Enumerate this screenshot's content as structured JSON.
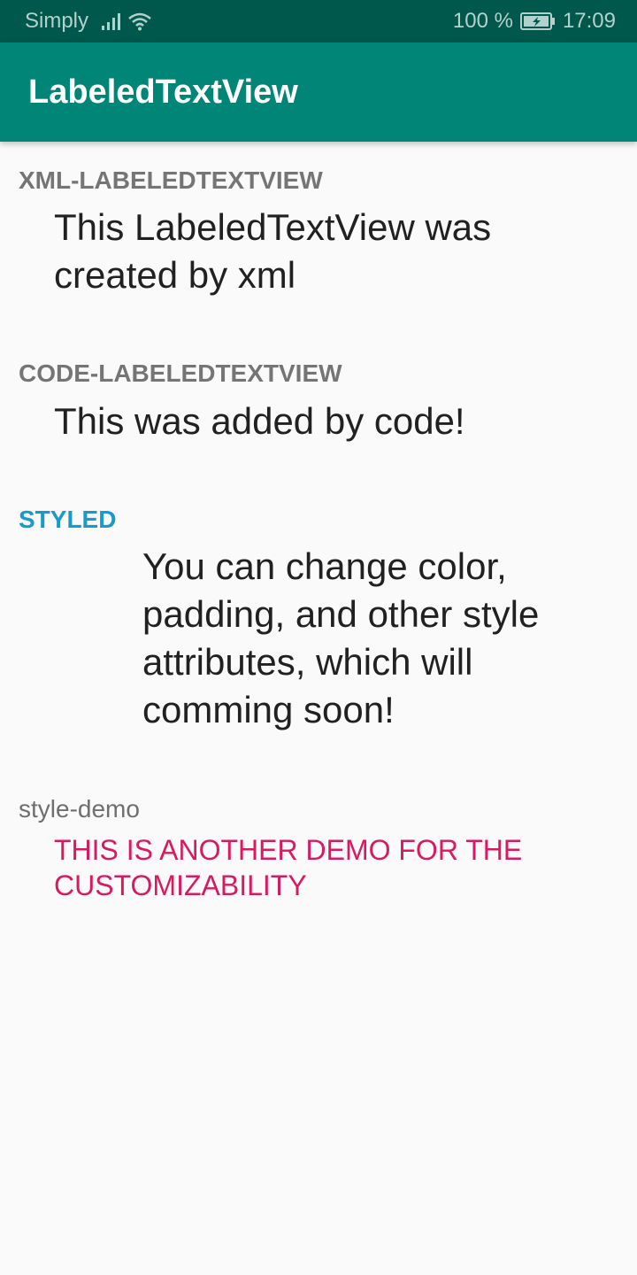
{
  "status_bar": {
    "carrier": "Simply",
    "battery_percent": "100 %",
    "time": "17:09",
    "icons": [
      "signal-icon",
      "wifi-icon",
      "battery-charging-icon"
    ],
    "background_color": "#00574b"
  },
  "app_bar": {
    "title": "LabeledTextView",
    "background_color": "#008577"
  },
  "items": [
    {
      "label": "XML-LABELEDTEXTVIEW",
      "value": "This LabeledTextView was created by xml",
      "label_color": "#757575"
    },
    {
      "label": "CODE-LABELEDTEXTVIEW",
      "value": "This was added by code!",
      "label_color": "#757575"
    },
    {
      "label": "STYLED",
      "value": "You can change color, padding, and other style attributes, which will comming soon!",
      "label_color": "#1a9ac9"
    },
    {
      "label": "style-demo",
      "value": "THIS IS ANOTHER DEMO FOR THE CUSTOMIZABILITY",
      "label_color": "#6f6f6f",
      "value_color": "#d81b60"
    }
  ]
}
